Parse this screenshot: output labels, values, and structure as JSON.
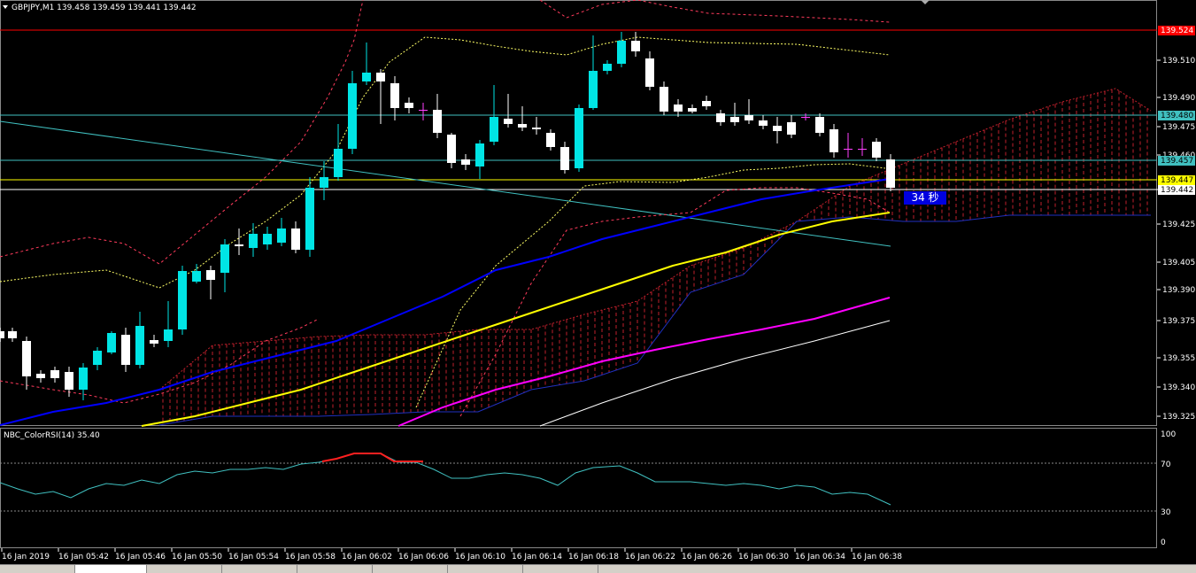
{
  "header": {
    "symbol_label": "GBPJPY,M1  139.458 139.459 139.441 139.442"
  },
  "indicator": {
    "label": "NBC_ColorRSI(14) 35.40",
    "ticks": [
      "100",
      "70",
      "30",
      "0"
    ]
  },
  "countdown": {
    "text": "34 秒"
  },
  "price_axis": {
    "ticks": [
      "139.510",
      "139.490",
      "139.475",
      "139.460",
      "139.440",
      "139.425",
      "139.405",
      "139.390",
      "139.375",
      "139.355",
      "139.340",
      "139.325"
    ]
  },
  "price_tags": [
    {
      "text": "139.524",
      "bg": "#ff0000",
      "fg": "#ffffff"
    },
    {
      "text": "139.480",
      "bg": "#40c0c0",
      "fg": "#000000"
    },
    {
      "text": "139.457",
      "bg": "#40c0c0",
      "fg": "#000000"
    },
    {
      "text": "139.447",
      "bg": "#ffff00",
      "fg": "#000000"
    },
    {
      "text": "139.442",
      "bg": "#ffffff",
      "fg": "#000000"
    }
  ],
  "time_axis": {
    "ticks": [
      "16 Jan 2019",
      "16 Jan 05:42",
      "16 Jan 05:46",
      "16 Jan 05:50",
      "16 Jan 05:54",
      "16 Jan 05:58",
      "16 Jan 06:02",
      "16 Jan 06:06",
      "16 Jan 06:10",
      "16 Jan 06:14",
      "16 Jan 06:18",
      "16 Jan 06:22",
      "16 Jan 06:26",
      "16 Jan 06:30",
      "16 Jan 06:34",
      "16 Jan 06:38"
    ]
  },
  "colors": {
    "bull": "#00e5e5",
    "bear": "#ffffff",
    "doji": "#ff40ff",
    "ma_blue": "#0000ff",
    "ma_yellow": "#ffff00",
    "ma_magenta": "#ff00ff",
    "ma_white": "#ffffff",
    "bollinger": "#ff3b5c",
    "bollinger_mid": "#ffff66",
    "cloud": "#c0202c",
    "rsi": "#40c0c0",
    "rsi_over": "#ff2020"
  }
}
